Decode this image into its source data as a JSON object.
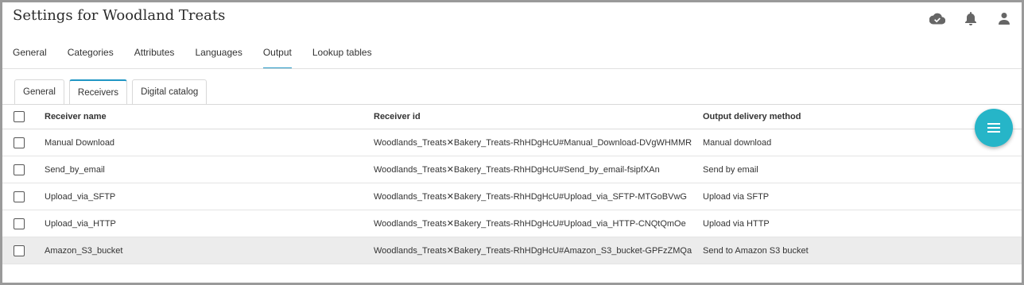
{
  "header": {
    "title": "Settings for Woodland Treats"
  },
  "icons": {
    "cloud": "cloud-check-icon",
    "bell": "bell-icon",
    "user": "account-icon",
    "fab": "menu-icon"
  },
  "nav": {
    "tabs": [
      {
        "label": "General"
      },
      {
        "label": "Categories"
      },
      {
        "label": "Attributes"
      },
      {
        "label": "Languages"
      },
      {
        "label": "Output",
        "active": true
      },
      {
        "label": "Lookup tables"
      }
    ]
  },
  "subtabs": [
    {
      "label": "General"
    },
    {
      "label": "Receivers",
      "active": true
    },
    {
      "label": "Digital catalog"
    }
  ],
  "table": {
    "columns": [
      "Receiver name",
      "Receiver id",
      "Output delivery method"
    ],
    "rows": [
      {
        "name": "Manual Download",
        "id": "Woodlands_Treats✕Bakery_Treats-RhHDgHcU#Manual_Download-DVgWHMMR",
        "method": "Manual download"
      },
      {
        "name": "Send_by_email",
        "id": "Woodlands_Treats✕Bakery_Treats-RhHDgHcU#Send_by_email-fsipfXAn",
        "method": "Send by email"
      },
      {
        "name": "Upload_via_SFTP",
        "id": "Woodlands_Treats✕Bakery_Treats-RhHDgHcU#Upload_via_SFTP-MTGoBVwG",
        "method": "Upload via SFTP"
      },
      {
        "name": "Upload_via_HTTP",
        "id": "Woodlands_Treats✕Bakery_Treats-RhHDgHcU#Upload_via_HTTP-CNQtQmOe",
        "method": "Upload via HTTP"
      },
      {
        "name": "Amazon_S3_bucket",
        "id": "Woodlands_Treats✕Bakery_Treats-RhHDgHcU#Amazon_S3_bucket-GPFzZMQa",
        "method": "Send to Amazon S3 bucket",
        "highlight": true
      }
    ]
  },
  "colors": {
    "accent": "#2196c4",
    "fab": "#26b5c8",
    "highlight_row": "#ececec"
  }
}
